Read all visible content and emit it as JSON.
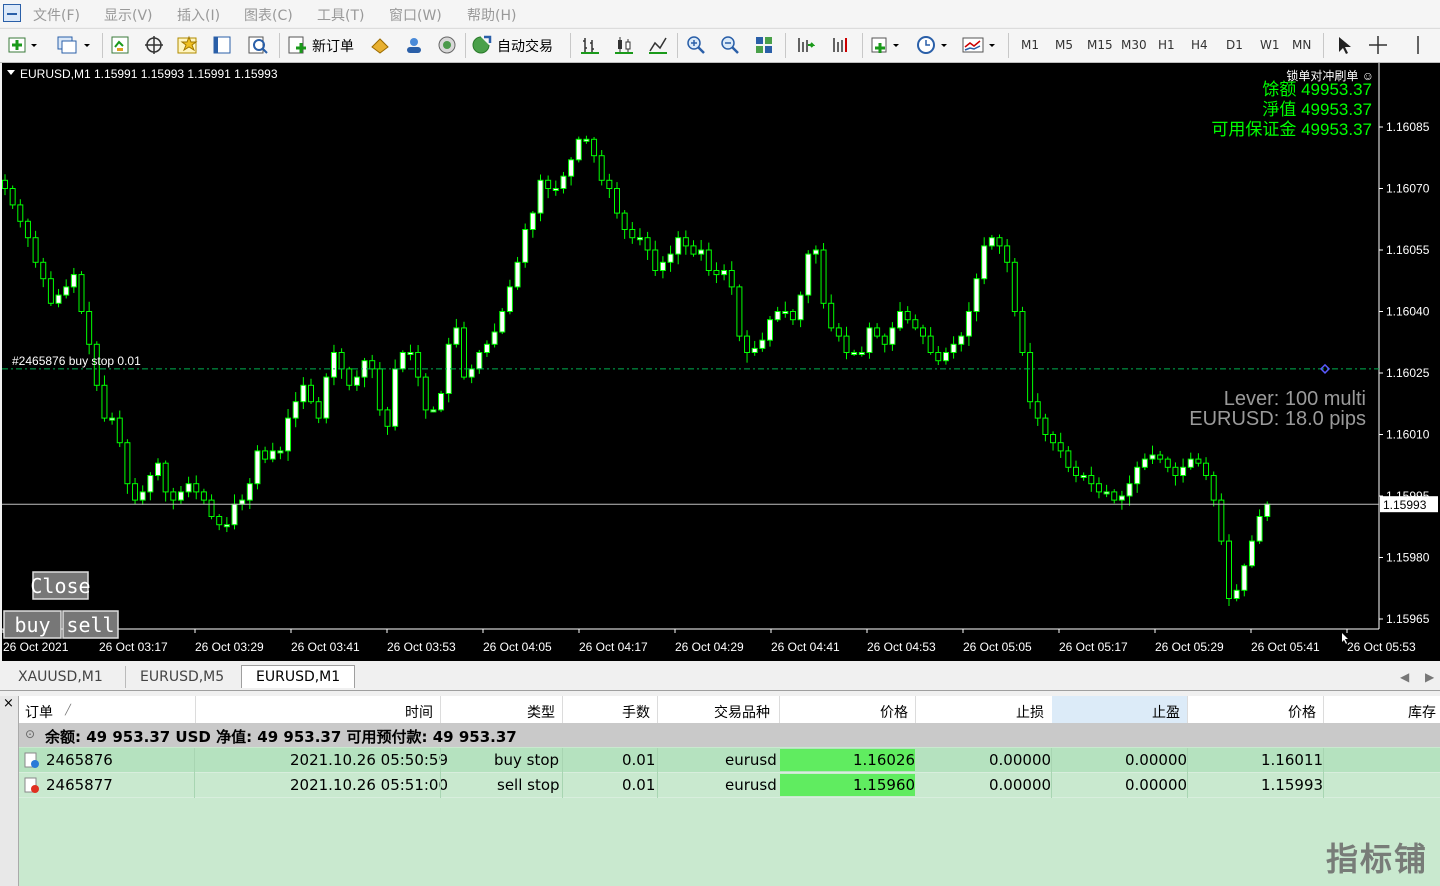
{
  "menu": [
    "文件(F)",
    "显示(V)",
    "插入(I)",
    "图表(C)",
    "工具(T)",
    "窗口(W)",
    "帮助(H)"
  ],
  "toolbar": {
    "new_order": "新订单",
    "auto_trade": "自动交易",
    "timeframes": [
      "M1",
      "M5",
      "M15",
      "M30",
      "H1",
      "H4",
      "D1",
      "W1",
      "MN"
    ]
  },
  "chart": {
    "header": "EURUSD,M1  1.15991 1.15993 1.15991 1.15993",
    "ea_title": "锁单对冲刷单 ☺",
    "balance_label": "馀额",
    "balance_value": "49953.37",
    "equity_label": "淨值",
    "equity_value": "49953.37",
    "margin_label": "可用保证金",
    "margin_value": "49953.37",
    "lever_text": "Lever: 100 multi",
    "spread_text": "EURUSD: 18.0 pips",
    "order_line_label": "#2465876 buy stop 0.01",
    "current_price": "1.15993",
    "btn_close": "Close",
    "btn_buy": "buy",
    "btn_sell": "sell",
    "colors": {
      "bg": "#000000",
      "up": "#00ff00",
      "candle_body": "#ffffff",
      "order_line": "#00b050",
      "price_line": "#c0c0c0"
    }
  },
  "chart_data": {
    "type": "candlestick",
    "y_axis_labels": [
      "1.16085",
      "1.16070",
      "1.16055",
      "1.16040",
      "1.16025",
      "1.16010",
      "1.15995",
      "1.15980",
      "1.15965"
    ],
    "x_axis_labels": [
      "26 Oct 2021",
      "26 Oct 03:17",
      "26 Oct 03:29",
      "26 Oct 03:41",
      "26 Oct 03:53",
      "26 Oct 04:05",
      "26 Oct 04:17",
      "26 Oct 04:29",
      "26 Oct 04:41",
      "26 Oct 04:53",
      "26 Oct 05:05",
      "26 Oct 05:17",
      "26 Oct 05:29",
      "26 Oct 05:41",
      "26 Oct 05:53"
    ],
    "ylim": [
      1.15962,
      1.1609
    ],
    "close_path": [
      1.1607,
      1.16066,
      1.16062,
      1.16058,
      1.16052,
      1.16048,
      1.16042,
      1.16044,
      1.16046,
      1.16049,
      1.1604,
      1.16032,
      1.16022,
      1.16014,
      1.16014,
      1.16008,
      1.15998,
      1.15994,
      1.15996,
      1.16,
      1.16003,
      1.15996,
      1.15994,
      1.15996,
      1.15998,
      1.15996,
      1.15994,
      1.1599,
      1.15988,
      1.15988,
      1.15993,
      1.15994,
      1.15998,
      1.16006,
      1.16004,
      1.16006,
      1.16006,
      1.16014,
      1.16018,
      1.16022,
      1.16018,
      1.16014,
      1.16024,
      1.1603,
      1.16026,
      1.16022,
      1.16024,
      1.16028,
      1.16026,
      1.16016,
      1.16012,
      1.16026,
      1.1603,
      1.1603,
      1.16024,
      1.16016,
      1.16016,
      1.1602,
      1.16032,
      1.16036,
      1.16024,
      1.16026,
      1.1603,
      1.16032,
      1.16035,
      1.1604,
      1.16046,
      1.16052,
      1.1606,
      1.16064,
      1.16072,
      1.1607,
      1.1607,
      1.16073,
      1.16077,
      1.16082,
      1.16082,
      1.16078,
      1.16072,
      1.1607,
      1.16064,
      1.1606,
      1.16058,
      1.16058,
      1.16055,
      1.1605,
      1.16052,
      1.16054,
      1.16058,
      1.16056,
      1.16054,
      1.16055,
      1.1605,
      1.16049,
      1.1605,
      1.16046,
      1.16034,
      1.1603,
      1.16031,
      1.16033,
      1.16038,
      1.1604,
      1.1604,
      1.16038,
      1.16044,
      1.16054,
      1.16055,
      1.16042,
      1.16036,
      1.16034,
      1.1603,
      1.1603,
      1.1603,
      1.16036,
      1.16034,
      1.16032,
      1.16036,
      1.1604,
      1.16038,
      1.16036,
      1.16034,
      1.1603,
      1.16028,
      1.1603,
      1.16032,
      1.16034,
      1.1604,
      1.16048,
      1.16056,
      1.16058,
      1.16056,
      1.16052,
      1.1604,
      1.1603,
      1.16018,
      1.16014,
      1.1601,
      1.16008,
      1.16006,
      1.16002,
      1.16,
      1.16,
      1.15998,
      1.15996,
      1.15996,
      1.15994,
      1.15995,
      1.15998,
      1.16002,
      1.16004,
      1.16005,
      1.16004,
      1.16002,
      1.16,
      1.16002,
      1.16004,
      1.16003,
      1.16,
      1.15994,
      1.15984,
      1.1597,
      1.15972,
      1.15978,
      1.15984,
      1.1599,
      1.15993
    ]
  },
  "bottom_tabs": [
    "XAUUSD,M1",
    "EURUSD,M5",
    "EURUSD,M1"
  ],
  "terminal": {
    "close_icon": "×",
    "columns": [
      "订单",
      "时间",
      "类型",
      "手数",
      "交易品种",
      "价格",
      "止损",
      "止盈",
      "价格",
      "库存"
    ],
    "summary": "余额: 49 953.37 USD  净值: 49 953.37  可用预付款: 49 953.37",
    "rows": [
      {
        "order": "2465876",
        "time": "2021.10.26 05:50:59",
        "type": "buy stop",
        "lots": "0.01",
        "symbol": "eurusd",
        "price": "1.16026",
        "sl": "0.00000",
        "tp": "0.00000",
        "cur": "1.16011"
      },
      {
        "order": "2465877",
        "time": "2021.10.26 05:51:00",
        "type": "sell stop",
        "lots": "0.01",
        "symbol": "eurusd",
        "price": "1.15960",
        "sl": "0.00000",
        "tp": "0.00000",
        "cur": "1.15993"
      }
    ]
  },
  "watermark": "指标铺"
}
